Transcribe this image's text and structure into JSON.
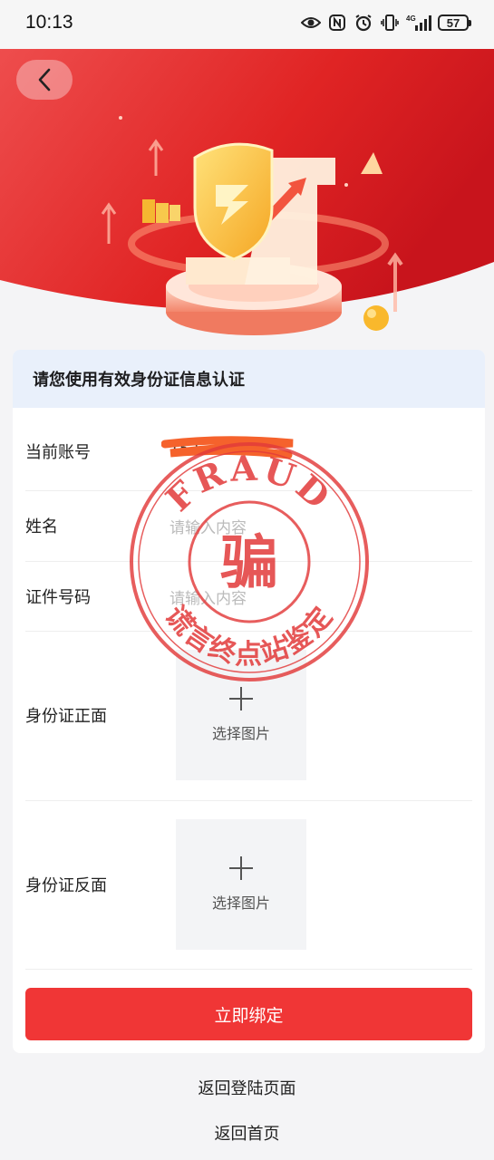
{
  "status_bar": {
    "time": "10:13",
    "network": "4G",
    "battery": "57"
  },
  "header": {
    "back_icon": "chevron-left-icon"
  },
  "form": {
    "banner": "请您使用有效身份证信息认证",
    "account_label": "当前账号",
    "account_value": "152",
    "name_label": "姓名",
    "name_placeholder": "请输入内容",
    "id_label": "证件号码",
    "id_placeholder": "请输入内容",
    "id_front_label": "身份证正面",
    "id_back_label": "身份证反面",
    "upload_text": "选择图片",
    "submit_label": "立即绑定"
  },
  "links": {
    "back_to_login": "返回登陆页面",
    "back_to_home": "返回首页"
  },
  "stamp": {
    "top_text": "FRAUD",
    "center_text": "骗",
    "bottom_text": "谎言终点站鉴定"
  },
  "colors": {
    "brand_red": "#f03636",
    "stamp_red": "#e23a3a",
    "banner_bg": "#e9f0fb"
  }
}
